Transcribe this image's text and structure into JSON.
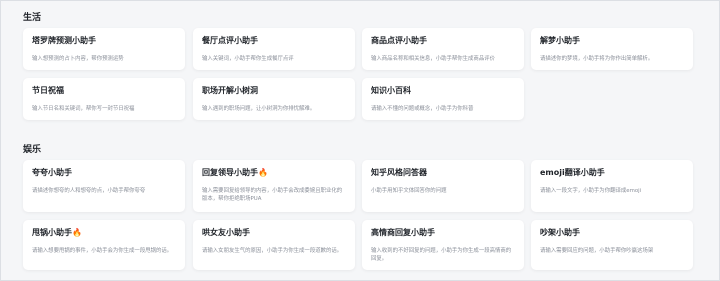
{
  "sections": [
    {
      "title": "生活",
      "cards": [
        {
          "title": "塔罗牌预测小助手",
          "desc": "输入想预测的占卜内容，帮你预测运势"
        },
        {
          "title": "餐厅点评小助手",
          "desc": "输入关键词，小助手帮你生成餐厅点评"
        },
        {
          "title": "商品点评小助手",
          "desc": "输入商品名称和相关信息，小助手帮你生成商品评价"
        },
        {
          "title": "解梦小助手",
          "desc": "请描述你的梦境，小助手将为你作出简单解析。"
        },
        {
          "title": "节日祝福",
          "desc": "输入节日名和关键词，帮你写一封节日祝福"
        },
        {
          "title": "职场开解小树洞",
          "desc": "输入遇到的职场问题，让小树洞为你排忧解难。"
        },
        {
          "title": "知识小百科",
          "desc": "请输入不懂的问题或概念，小助手为你科普"
        }
      ]
    },
    {
      "title": "娱乐",
      "cards": [
        {
          "title": "夸夸小助手",
          "desc": "请描述你想夸的人和想夸的点，小助手帮你夸夸",
          "fire": false
        },
        {
          "title": "回复领导小助手",
          "desc": "输入需要回复给领导的内容，小助手会改成委婉且职业化的版本，帮你拒绝职场PUA",
          "fire": true
        },
        {
          "title": "知乎风格问答器",
          "desc": "小助手用知乎文体回答你的问题",
          "fire": false
        },
        {
          "title": "emoji翻译小助手",
          "desc": "请输入一段文字，小助手为你翻译成emoji",
          "fire": false
        },
        {
          "title": "甩锅小助手",
          "desc": "请输入想要甩锅的事件，小助手会为你生成一段甩锅的话。",
          "fire": true
        },
        {
          "title": "哄女友小助手",
          "desc": "请输入女朋友生气的原因，小助手为你生成一段道歉的话。",
          "fire": false
        },
        {
          "title": "高情商回复小助手",
          "desc": "输入收到的不好回复的问题，小助手为你生成一段高情商的回复。",
          "fire": false
        },
        {
          "title": "吵架小助手",
          "desc": "请输入需要回应的问题，小助手帮你吵赢这场架",
          "fire": false
        }
      ]
    }
  ],
  "icons": {
    "hot": "fire-icon"
  },
  "colors": {
    "background": "#f5f6f8",
    "card": "#ffffff",
    "title": "#1f2329",
    "desc": "#8a8f99"
  }
}
